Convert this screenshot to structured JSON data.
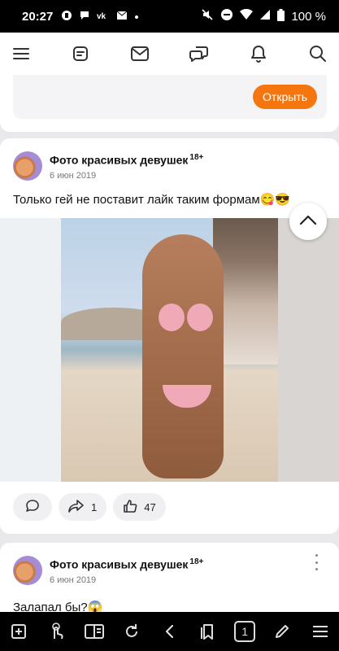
{
  "status": {
    "time": "20:27",
    "battery": "100 %"
  },
  "promo": {
    "open_label": "Открыть"
  },
  "posts": [
    {
      "group": "Фото красивых девушек",
      "age": "18+",
      "date": "6 июн 2019",
      "text": "Только гей не поставит лайк таким формам😋😎",
      "shares": "1",
      "likes": "47"
    },
    {
      "group": "Фото красивых девушек",
      "age": "18+",
      "date": "6 июн 2019",
      "text": "Залапал бы?😱"
    }
  ],
  "browser": {
    "tab_count": "1"
  },
  "colors": {
    "accent": "#f5760e"
  }
}
